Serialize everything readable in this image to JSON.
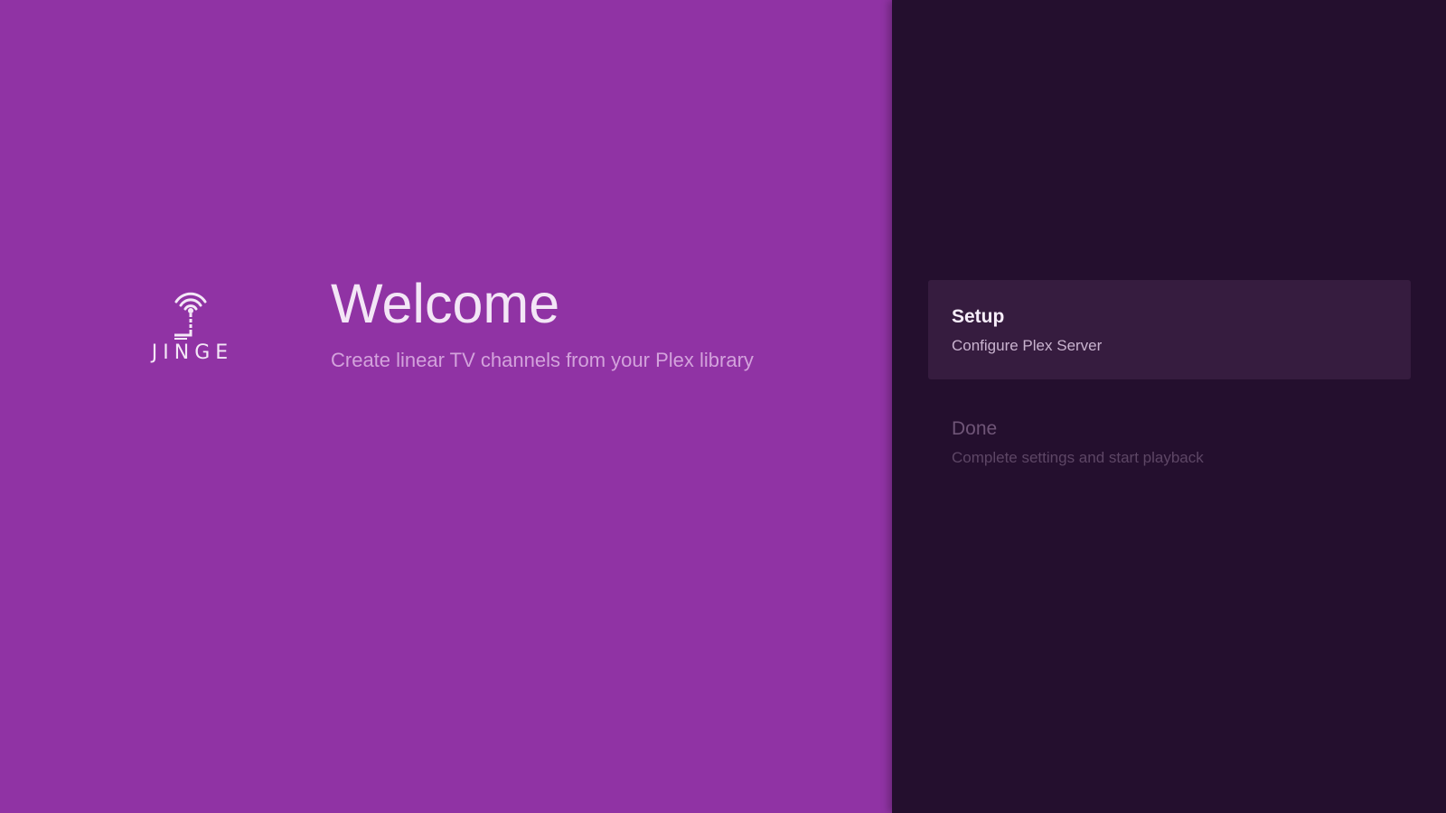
{
  "logo": {
    "icon": "antenna-broadcast-icon",
    "text": "JINGE"
  },
  "welcome": {
    "title": "Welcome",
    "subtitle": "Create linear TV channels from your Plex library"
  },
  "actions": [
    {
      "title": "Setup",
      "description": "Configure Plex Server",
      "state": "focused"
    },
    {
      "title": "Done",
      "description": "Complete settings and start playback",
      "state": "dimmed"
    }
  ],
  "colors": {
    "left_background": "#9033a4",
    "right_background": "#240f2e",
    "focused_item": "#361c3f"
  }
}
